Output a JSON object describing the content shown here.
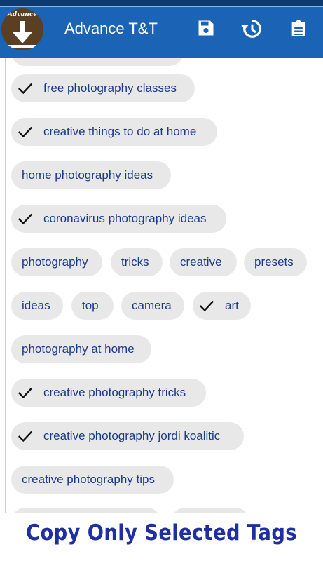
{
  "app": {
    "title": "Advance T&T",
    "logo_text": "Advance"
  },
  "toolbar": {
    "icons": [
      "save-icon",
      "history-icon",
      "clipboard-icon"
    ]
  },
  "colors": {
    "appbar": "#1a63b5",
    "chip_background": "#e8e8e8",
    "chip_text": "#1b3a8a",
    "footer_text": "#1f2fa0"
  },
  "tags": [
    {
      "label": "free photography classes",
      "selected": true
    },
    {
      "label": "creative things to do at home",
      "selected": true
    },
    {
      "label": "home photography ideas",
      "selected": false
    },
    {
      "label": "coronavirus photography ideas",
      "selected": true
    },
    {
      "label": "photography",
      "selected": false
    },
    {
      "label": "tricks",
      "selected": false
    },
    {
      "label": "creative",
      "selected": false
    },
    {
      "label": "presets",
      "selected": false
    },
    {
      "label": "ideas",
      "selected": false
    },
    {
      "label": "top",
      "selected": false
    },
    {
      "label": "camera",
      "selected": false
    },
    {
      "label": "art",
      "selected": true
    },
    {
      "label": "photography at home",
      "selected": false
    },
    {
      "label": "creative photography tricks",
      "selected": true
    },
    {
      "label": "creative photography jordi koalitic",
      "selected": true
    },
    {
      "label": "creative photography tips",
      "selected": false
    }
  ],
  "footer": {
    "button_label": "Copy Only Selected Tags"
  }
}
